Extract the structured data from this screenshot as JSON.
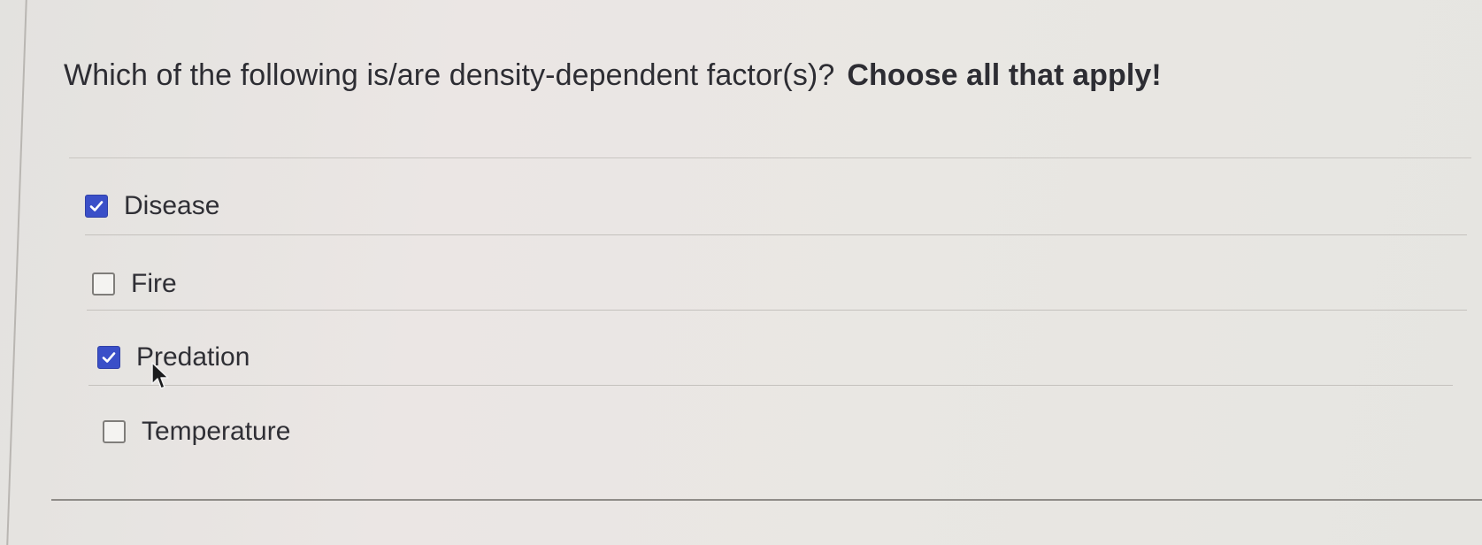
{
  "question": {
    "text": "Which of the following is/are density-dependent factor(s)?",
    "instruction": "Choose all that apply!"
  },
  "options": [
    {
      "label": "Disease",
      "checked": true
    },
    {
      "label": "Fire",
      "checked": false
    },
    {
      "label": "Predation",
      "checked": true
    },
    {
      "label": "Temperature",
      "checked": false
    }
  ],
  "colors": {
    "checkbox_checked": "#3a4fc8",
    "text": "#2d2d33"
  },
  "icons": {
    "checked": "checkmark-icon",
    "cursor": "mouse-pointer-icon"
  }
}
